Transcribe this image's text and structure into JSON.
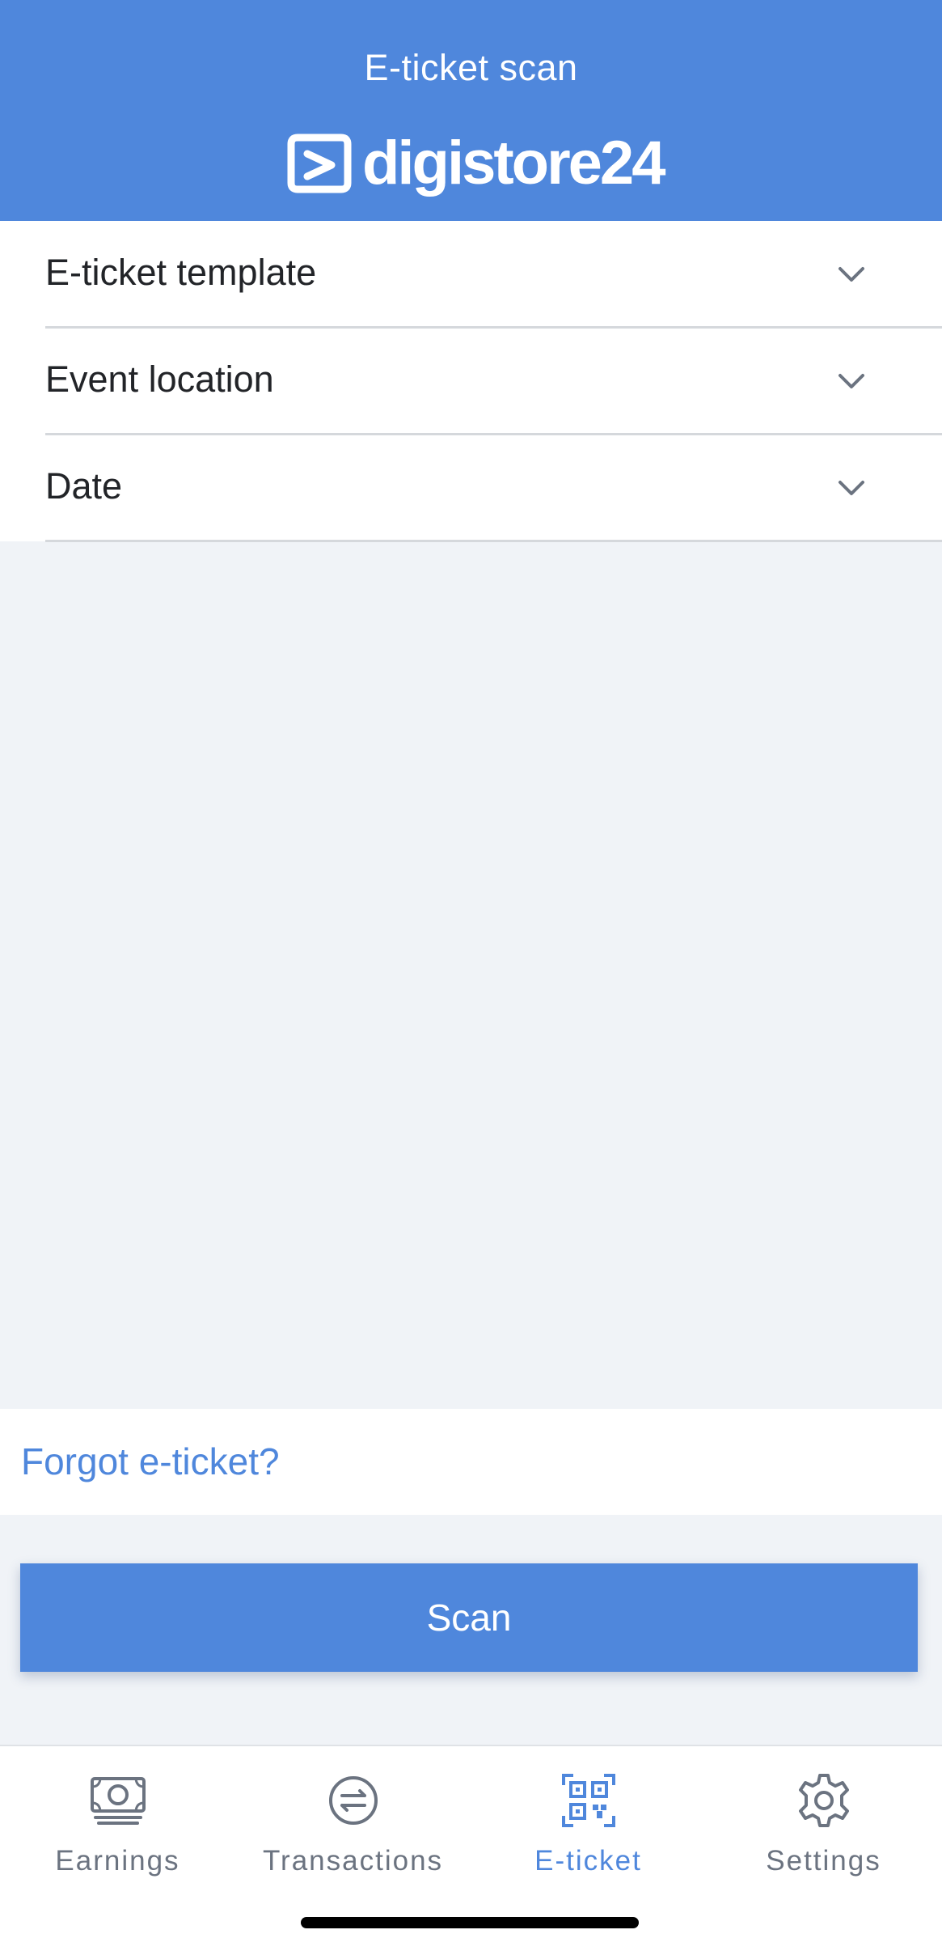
{
  "header": {
    "title": "E-ticket scan",
    "logo_text": "digistore24",
    "logo_icon": "digistore-logo-icon"
  },
  "filters": [
    {
      "label": "E-ticket template",
      "icon": "chevron-down-icon"
    },
    {
      "label": "Event location",
      "icon": "chevron-down-icon"
    },
    {
      "label": "Date",
      "icon": "chevron-down-icon"
    }
  ],
  "forgot_link": "Forgot e-ticket?",
  "scan_button": "Scan",
  "tabs": [
    {
      "label": "Earnings",
      "icon": "money-icon",
      "active": false
    },
    {
      "label": "Transactions",
      "icon": "exchange-icon",
      "active": false
    },
    {
      "label": "E-ticket",
      "icon": "qr-code-icon",
      "active": true
    },
    {
      "label": "Settings",
      "icon": "gear-icon",
      "active": false
    }
  ],
  "colors": {
    "brand": "#4f87dc",
    "text": "#222428",
    "inactive": "#6b7380",
    "background": "#f0f3f7"
  }
}
